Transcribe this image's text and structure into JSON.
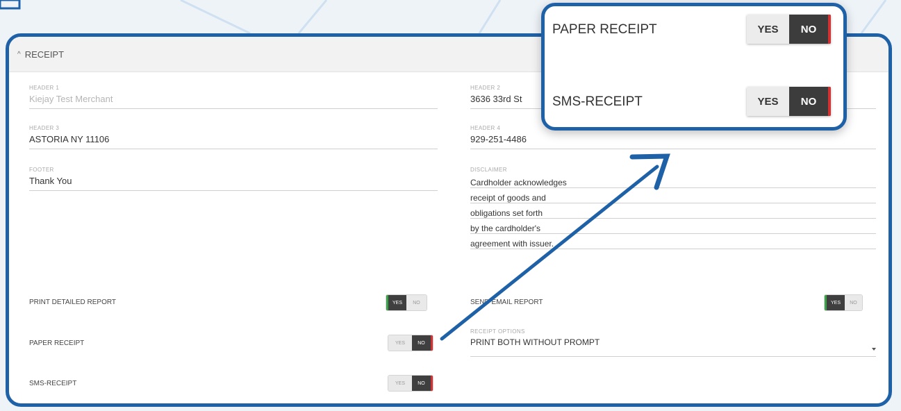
{
  "receipt": {
    "section_title": "RECEIPT",
    "header1": {
      "label": "HEADER 1",
      "value": "Kiejay Test Merchant"
    },
    "header2": {
      "label": "HEADER 2",
      "value": "3636 33rd St"
    },
    "header3": {
      "label": "HEADER 3",
      "value": "ASTORIA NY 11106"
    },
    "header4": {
      "label": "HEADER 4",
      "value": "929-251-4486"
    },
    "footer": {
      "label": "FOOTER",
      "value": "Thank You"
    },
    "disclaimer": {
      "label": "DISCLAIMER",
      "lines": [
        "Cardholder acknowledges",
        "receipt of goods and",
        "obligations set forth",
        "by the cardholder's",
        "agreement with issuer."
      ]
    },
    "print_detailed_report": {
      "label": "PRINT DETAILED REPORT",
      "yes": "YES",
      "no": "NO",
      "value": "YES"
    },
    "send_email_report": {
      "label": "SEND EMAIL REPORT",
      "yes": "YES",
      "no": "NO",
      "value": "YES"
    },
    "paper_receipt": {
      "label": "PAPER RECEIPT",
      "yes": "YES",
      "no": "NO",
      "value": "NO"
    },
    "sms_receipt": {
      "label": "SMS-RECEIPT",
      "yes": "YES",
      "no": "NO",
      "value": "NO"
    },
    "receipt_options": {
      "label": "RECEIPT OPTIONS",
      "value": "PRINT BOTH WITHOUT PROMPT"
    }
  },
  "zoom": {
    "paper_receipt": {
      "label": "PAPER RECEIPT",
      "yes": "YES",
      "no": "NO",
      "value": "NO"
    },
    "sms_receipt": {
      "label": "SMS-RECEIPT",
      "yes": "YES",
      "no": "NO",
      "value": "NO"
    }
  },
  "colors": {
    "accent": "#1f61a7",
    "toggle_yes": "#3aa34a",
    "toggle_no": "#d23232"
  }
}
